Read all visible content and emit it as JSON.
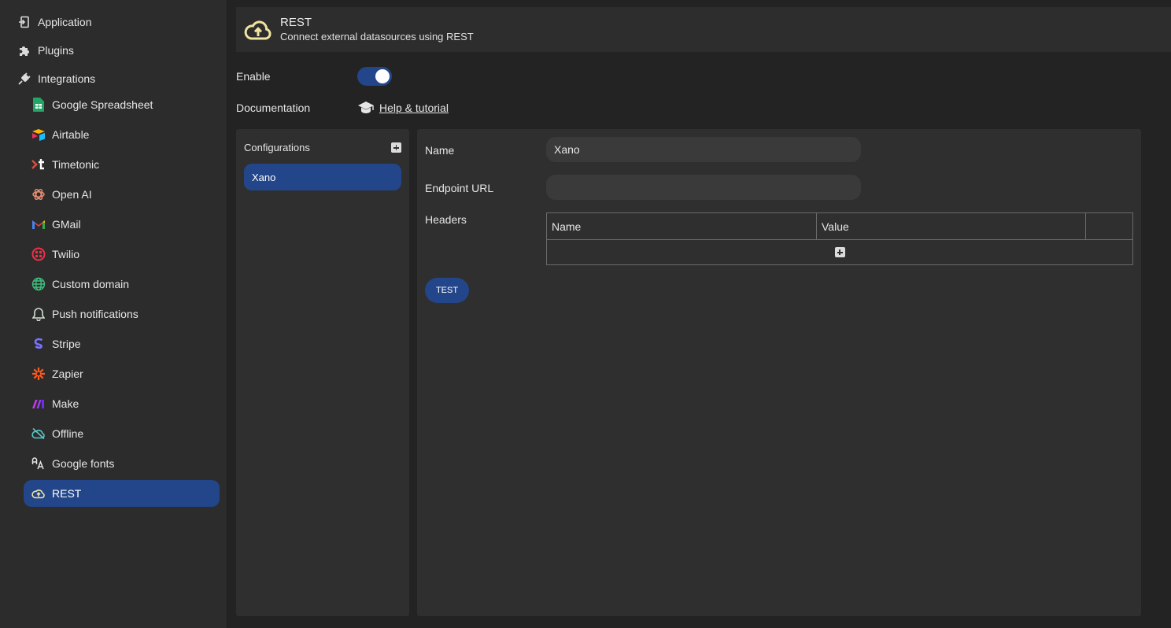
{
  "sidebar": {
    "top_items": [
      {
        "label": "Application",
        "icon": "app-entry-icon"
      },
      {
        "label": "Plugins",
        "icon": "puzzle-icon"
      },
      {
        "label": "Integrations",
        "icon": "plug-icon"
      }
    ],
    "integrations": [
      {
        "label": "Google Spreadsheet",
        "icon": "google-sheets-icon"
      },
      {
        "label": "Airtable",
        "icon": "airtable-icon"
      },
      {
        "label": "Timetonic",
        "icon": "timetonic-icon"
      },
      {
        "label": "Open AI",
        "icon": "openai-icon"
      },
      {
        "label": "GMail",
        "icon": "gmail-icon"
      },
      {
        "label": "Twilio",
        "icon": "twilio-icon"
      },
      {
        "label": "Custom domain",
        "icon": "globe-icon"
      },
      {
        "label": "Push notifications",
        "icon": "bell-icon"
      },
      {
        "label": "Stripe",
        "icon": "stripe-icon"
      },
      {
        "label": "Zapier",
        "icon": "zapier-icon"
      },
      {
        "label": "Make",
        "icon": "make-icon"
      },
      {
        "label": "Offline",
        "icon": "cloud-off-icon"
      },
      {
        "label": "Google fonts",
        "icon": "font-icon"
      },
      {
        "label": "REST",
        "icon": "cloud-upload-icon",
        "active": true
      }
    ]
  },
  "header": {
    "title": "REST",
    "subtitle": "Connect external datasources using REST",
    "icon": "cloud-upload-icon"
  },
  "settings": {
    "enable_label": "Enable",
    "enabled": true,
    "documentation_label": "Documentation",
    "documentation_link": "Help & tutorial"
  },
  "configurations": {
    "title": "Configurations",
    "items": [
      "Xano"
    ],
    "selected": "Xano"
  },
  "detail": {
    "name_label": "Name",
    "name_value": "Xano",
    "endpoint_label": "Endpoint URL",
    "endpoint_value": "",
    "headers_label": "Headers",
    "headers_columns": [
      "Name",
      "Value",
      ""
    ],
    "test_label": "TEST"
  },
  "colors": {
    "accent": "#23468a",
    "sidebar_bg": "#2c2c2c",
    "page_bg": "#232323",
    "panel_bg": "#2f2f2f"
  }
}
